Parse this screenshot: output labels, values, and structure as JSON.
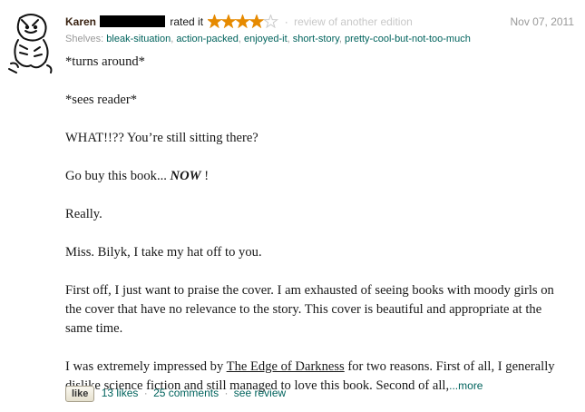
{
  "review": {
    "reviewer_name": "Karen",
    "rated_text": "rated it",
    "rating_stars": 4,
    "rating_max": 5,
    "star_color": "#e68a00",
    "star_empty_color": "#cccccc",
    "edition_note": "review of another edition",
    "date": "Nov 07, 2011",
    "shelves_label": "Shelves:",
    "shelves": [
      "bleak-situation",
      "action-packed",
      "enjoyed-it",
      "short-story",
      "pretty-cool-but-not-too-much"
    ],
    "avatar_icon": "cartoon-tiger-icon"
  },
  "body": {
    "p1": "*turns around*",
    "p2": "*sees reader*",
    "p3": "WHAT!!?? You’re still sitting there?",
    "p4_before": "Go buy this book... ",
    "p4_emph": "NOW",
    "p4_after": " !",
    "p5": "Really.",
    "p6": "Miss. Bilyk, I take my hat off to you.",
    "p7": "First off, I just want to praise the cover. I am exhausted of seeing books with moody girls on the cover that have no relevance to the story. This cover is beautiful and appropriate at the same time.",
    "p8_before": "I was extremely impressed by ",
    "p8_book": "The Edge of Darkness",
    "p8_after": " for two reasons. First of all, I generally dislike science fiction and still managed to love this book. Second of all,",
    "more_label": "...more"
  },
  "footer": {
    "like_label": "like",
    "likes": "13 likes",
    "comments": "25 comments",
    "see_review": "see review",
    "separator": "·"
  },
  "colors": {
    "link": "#00635d",
    "reviewer": "#382110",
    "muted": "#999999"
  }
}
